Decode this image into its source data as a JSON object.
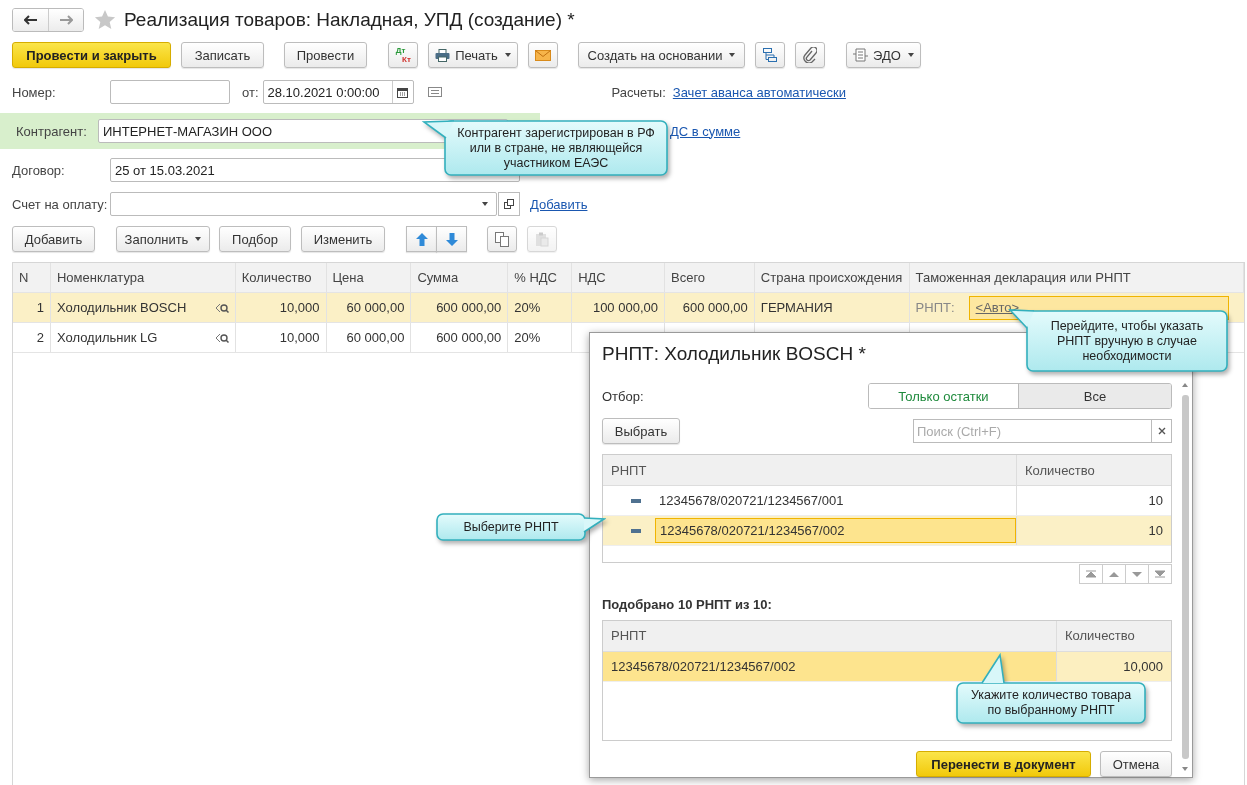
{
  "window": {
    "title": "Реализация товаров: Накладная, УПД (создание) *"
  },
  "toolbar": {
    "post_close": "Провести и закрыть",
    "save": "Записать",
    "post": "Провести",
    "dt": "Дт",
    "kt": "Кт",
    "print": "Печать",
    "create_based": "Создать на основании",
    "edo": "ЭДО"
  },
  "number": {
    "label": "Номер:"
  },
  "date": {
    "label": "от:",
    "value": "28.10.2021  0:00:00"
  },
  "settlements": {
    "label": "Расчеты:",
    "link": "Зачет аванса автоматически"
  },
  "counterparty": {
    "label": "Контрагент:",
    "value": "ИНТЕРНЕТ-МАГАЗИН ООО"
  },
  "vat_link": "ДС в сумме",
  "contract": {
    "label": "Договор:",
    "value": "25 от 15.03.2021"
  },
  "invoice": {
    "label": "Счет на оплату:",
    "link": "Добавить"
  },
  "table_toolbar": {
    "add": "Добавить",
    "fill": "Заполнить",
    "pick": "Подбор",
    "edit": "Изменить"
  },
  "table": {
    "columns": [
      "N",
      "Номенклатура",
      "Количество",
      "Цена",
      "Сумма",
      "% НДС",
      "НДС",
      "Всего",
      "Страна происхождения",
      "Таможенная декларация или РНПТ"
    ],
    "rows": [
      {
        "cells": [
          "1",
          "Холодильник BOSCH",
          "10,000",
          "60 000,00",
          "600 000,00",
          "20%",
          "100 000,00",
          "600 000,00",
          "ГЕРМАНИЯ"
        ],
        "customs_label": "РНПТ:",
        "customs_value": "<Авто>",
        "selected": true
      },
      {
        "cells": [
          "2",
          "Холодильник LG",
          "10,000",
          "60 000,00",
          "600 000,00",
          "20%"
        ],
        "selected": false
      }
    ]
  },
  "dialog": {
    "title": "РНПТ: Холодильник BOSCH *",
    "filter_label": "Отбор:",
    "filter_options": [
      {
        "label": "Только остатки",
        "selected": true
      },
      {
        "label": "Все",
        "selected": false
      }
    ],
    "choose": "Выбрать",
    "search_placeholder": "Поиск (Ctrl+F)",
    "list": {
      "columns": [
        "РНПТ",
        "Количество"
      ],
      "rows": [
        {
          "code": "12345678/020721/1234567/001",
          "qty": "10",
          "selected": false
        },
        {
          "code": "12345678/020721/1234567/002",
          "qty": "10",
          "selected": true
        }
      ]
    },
    "picked_caption": "Подобрано 10 РНПТ из 10:",
    "picked": {
      "columns": [
        "РНПТ",
        "Количество"
      ],
      "rows": [
        {
          "code": "12345678/020721/1234567/002",
          "qty": "10,000",
          "selected": true
        }
      ]
    },
    "ok": "Перенести в документ",
    "cancel": "Отмена"
  },
  "callouts": [
    {
      "text": "Контрагент зарегистрирован в РФ или в стране, не являющейся участником ЕАЭС"
    },
    {
      "text": "Перейдите, чтобы указать РНПТ вручную в случае необходимости"
    },
    {
      "text": "Выберите РНПТ"
    },
    {
      "text": "Укажите количество товара по выбранному РНПТ"
    }
  ]
}
